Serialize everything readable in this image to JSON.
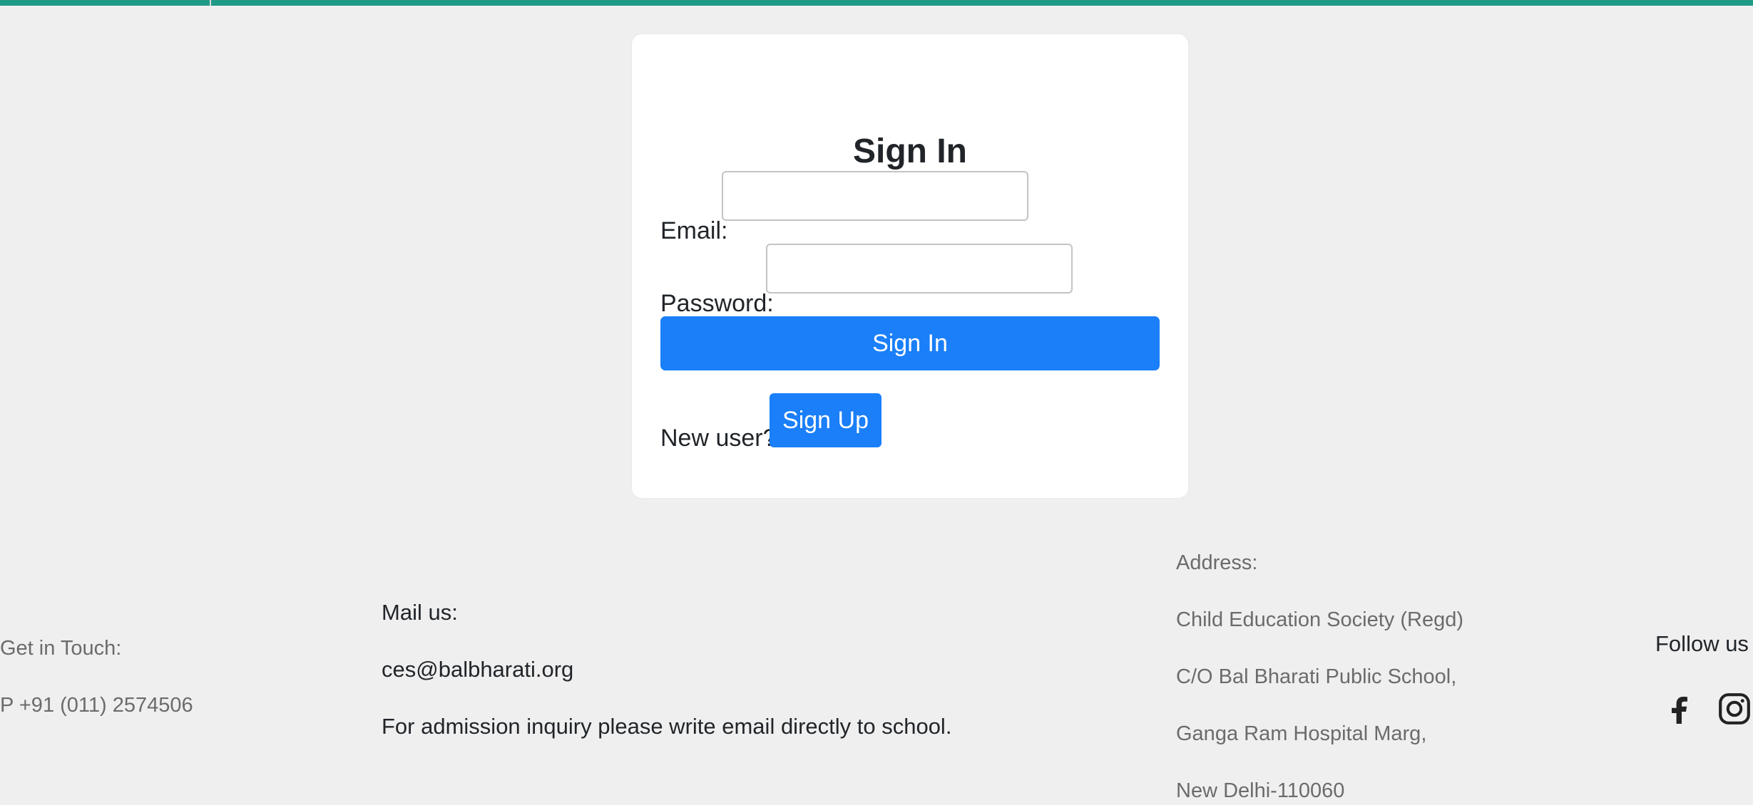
{
  "signin": {
    "title": "Sign In",
    "email_label": "Email:",
    "email_value": "",
    "email_placeholder": "",
    "password_label": "Password:",
    "password_value": "",
    "password_placeholder": "",
    "submit_label": "Sign In",
    "new_user_text": "New user?",
    "signup_label": "Sign Up"
  },
  "footer": {
    "contact": {
      "heading": "Get in Touch:",
      "phone": "P +91 (011) 2574506"
    },
    "mail": {
      "heading": "Mail us:",
      "email": "ces@balbharati.org",
      "note": "For admission inquiry please write email directly to school."
    },
    "address": {
      "heading": "Address:",
      "lines": [
        "Child Education Society (Regd)",
        "C/O Bal Bharati Public School,",
        "Ganga Ram Hospital Marg,",
        "New Delhi-110060"
      ]
    },
    "social": {
      "heading": "Follow us",
      "icons": [
        "facebook-icon",
        "instagram-icon"
      ]
    }
  },
  "colors": {
    "accent_bar": "#1f9a86",
    "primary_button": "#1a7ff8",
    "page_background": "#efefef"
  }
}
